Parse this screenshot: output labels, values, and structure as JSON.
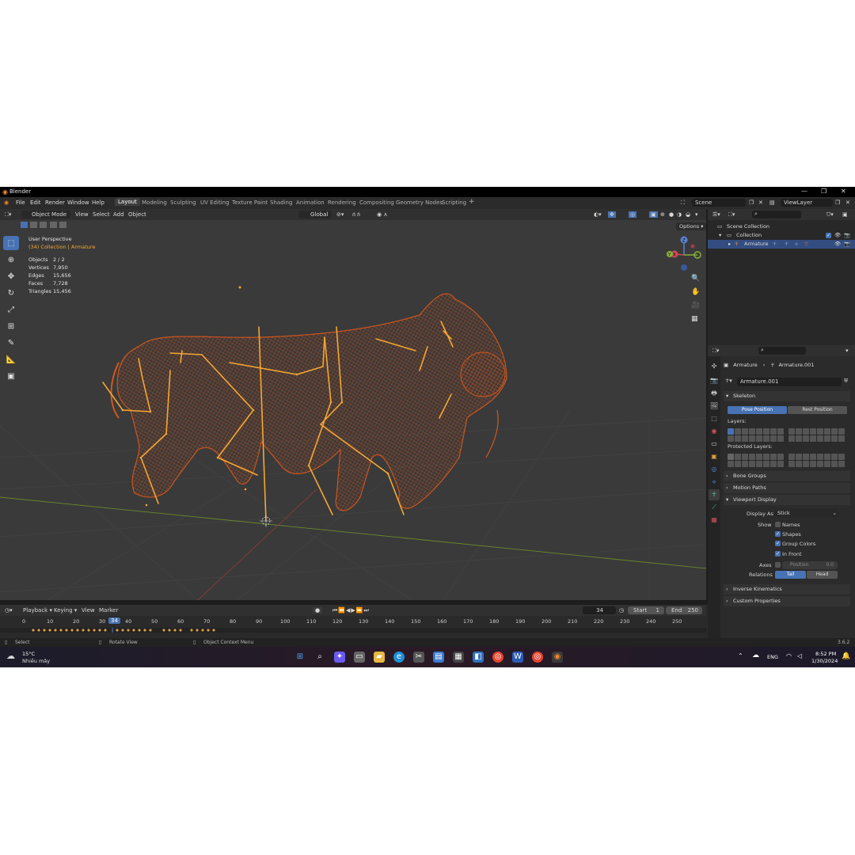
{
  "app": {
    "title": "Blender",
    "version": "3.6.2"
  },
  "menu": [
    "File",
    "Edit",
    "Render",
    "Window",
    "Help"
  ],
  "workspaces": [
    "Layout",
    "Modeling",
    "Sculpting",
    "UV Editing",
    "Texture Paint",
    "Shading",
    "Animation",
    "Rendering",
    "Compositing",
    "Geometry Nodes",
    "Scripting"
  ],
  "scene": {
    "name": "Scene",
    "view_layer": "ViewLayer"
  },
  "viewport": {
    "mode": "Object Mode",
    "menus": [
      "View",
      "Select",
      "Add",
      "Object"
    ],
    "transform_orientation": "Global",
    "options_label": "Options",
    "perspective": "User Perspective",
    "collection_line": "(34) Collection | Armature",
    "stats": [
      {
        "k": "Objects",
        "v": "2 / 2"
      },
      {
        "k": "Vertices",
        "v": "7,950"
      },
      {
        "k": "Edges",
        "v": "15,656"
      },
      {
        "k": "Faces",
        "v": "7,728"
      },
      {
        "k": "Triangles",
        "v": "15,456"
      }
    ],
    "gizmo": {
      "x": "X",
      "y": "Y",
      "z": "Z"
    }
  },
  "timeline": {
    "menus": [
      "Playback",
      "Keying",
      "View",
      "Marker"
    ],
    "current_frame": "34",
    "start_label": "Start",
    "start": "1",
    "end_label": "End",
    "end": "250",
    "ticks": [
      "0",
      "10",
      "20",
      "30",
      "34",
      "40",
      "50",
      "60",
      "70",
      "80",
      "90",
      "100",
      "110",
      "120",
      "130",
      "140",
      "150",
      "160",
      "170",
      "180",
      "190",
      "200",
      "210",
      "220",
      "230",
      "240",
      "250"
    ]
  },
  "statusbar": {
    "select": "Select",
    "rotate": "Rotate View",
    "context": "Object Context Menu"
  },
  "outliner": {
    "scene_collection": "Scene Collection",
    "collection": "Collection",
    "armature": "Armature"
  },
  "properties": {
    "breadcrumb_obj": "Armature",
    "breadcrumb_data": "Armature.001",
    "data_name": "Armature.001",
    "skeleton": "Skeleton",
    "pose_position": "Pose Position",
    "rest_position": "Rest Position",
    "layers": "Layers:",
    "protected_layers": "Protected Layers:",
    "bone_groups": "Bone Groups",
    "motion_paths": "Motion Paths",
    "viewport_display": "Viewport Display",
    "display_as_label": "Display As",
    "display_as_value": "Stick",
    "show_label": "Show",
    "names": "Names",
    "shapes": "Shapes",
    "group_colors": "Group Colors",
    "in_front": "In Front",
    "axes_label": "Axes",
    "position_label": "Position",
    "position_value": "0.0",
    "relations_label": "Relations",
    "tail": "Tail",
    "head": "Head",
    "inverse_kinematics": "Inverse Kinematics",
    "custom_properties": "Custom Properties"
  },
  "taskbar": {
    "temperature": "15°C",
    "weather": "Nhiều mây",
    "language": "ENG",
    "time": "8:52 PM",
    "date": "1/30/2024"
  },
  "colors": {
    "accent": "#4772b3",
    "wire": "#d2571e",
    "bone": "#f5a733"
  }
}
